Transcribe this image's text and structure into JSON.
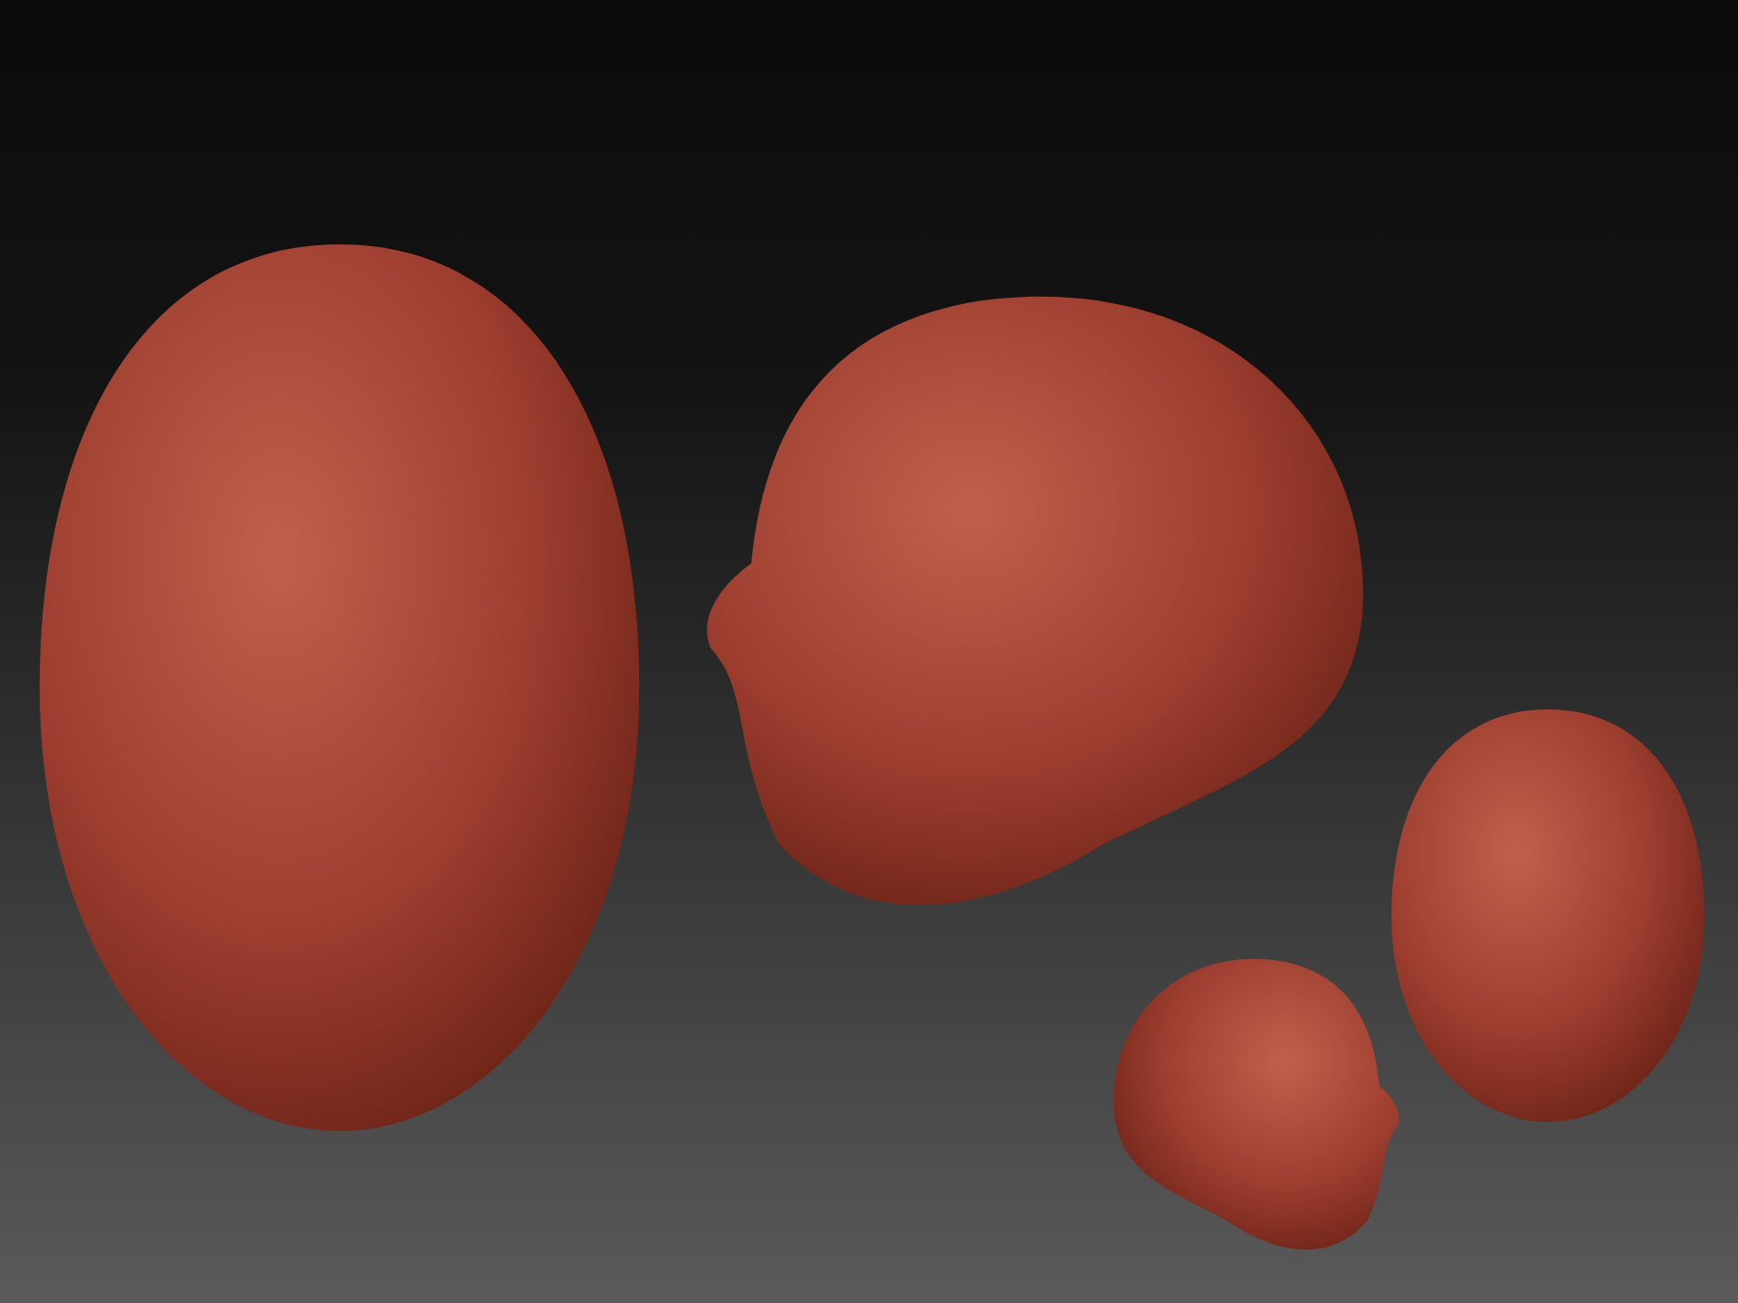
{
  "viewport": {
    "models": [
      {
        "kind": "front",
        "mirrored": false
      },
      {
        "kind": "side",
        "mirrored": false
      },
      {
        "kind": "side",
        "mirrored": true
      },
      {
        "kind": "front",
        "mirrored": false
      }
    ]
  }
}
